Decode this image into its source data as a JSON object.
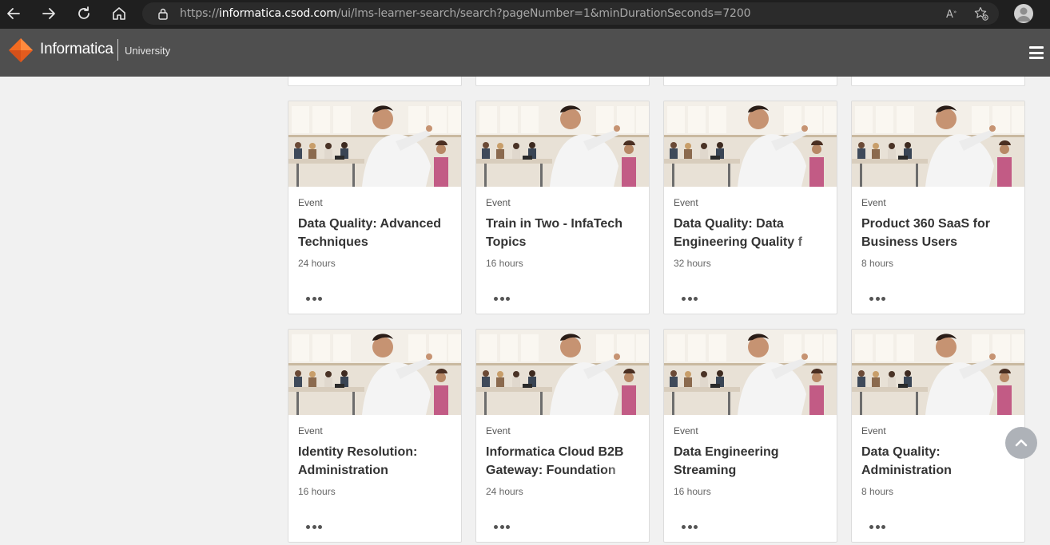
{
  "browser": {
    "url_prefix": "https://",
    "url_host": "informatica.csod.com",
    "url_path": "/ui/lms-learner-search/search?pageNumber=1&minDurationSeconds=7200",
    "icons": [
      "back-icon",
      "forward-icon",
      "refresh-icon",
      "home-icon",
      "lock-icon",
      "read-aloud-icon",
      "favorites-icon",
      "profile-icon"
    ]
  },
  "header": {
    "logo_text": "Informatica",
    "logo_sub": "University",
    "colors": {
      "bar": "#4f4f4f",
      "logo_orange": "#f26b21"
    }
  },
  "cards": [
    {
      "type": "Event",
      "title": "Data Quality: Advanced Techniques",
      "duration": "24 hours"
    },
    {
      "type": "Event",
      "title": "Train in Two - InfaTech Topics",
      "duration": "16 hours"
    },
    {
      "type": "Event",
      "title": "Data Quality: Data Engineering Quality f",
      "duration": "32 hours"
    },
    {
      "type": "Event",
      "title": "Product 360 SaaS for Business Users",
      "duration": "8 hours"
    },
    {
      "type": "Event",
      "title": "Identity Resolution: Administration",
      "duration": "16 hours"
    },
    {
      "type": "Event",
      "title": "Informatica Cloud B2B Gateway: Foundation",
      "duration": "24 hours"
    },
    {
      "type": "Event",
      "title": "Data Engineering Streaming",
      "duration": "16 hours"
    },
    {
      "type": "Event",
      "title": "Data Quality: Administration",
      "duration": "8 hours"
    }
  ]
}
